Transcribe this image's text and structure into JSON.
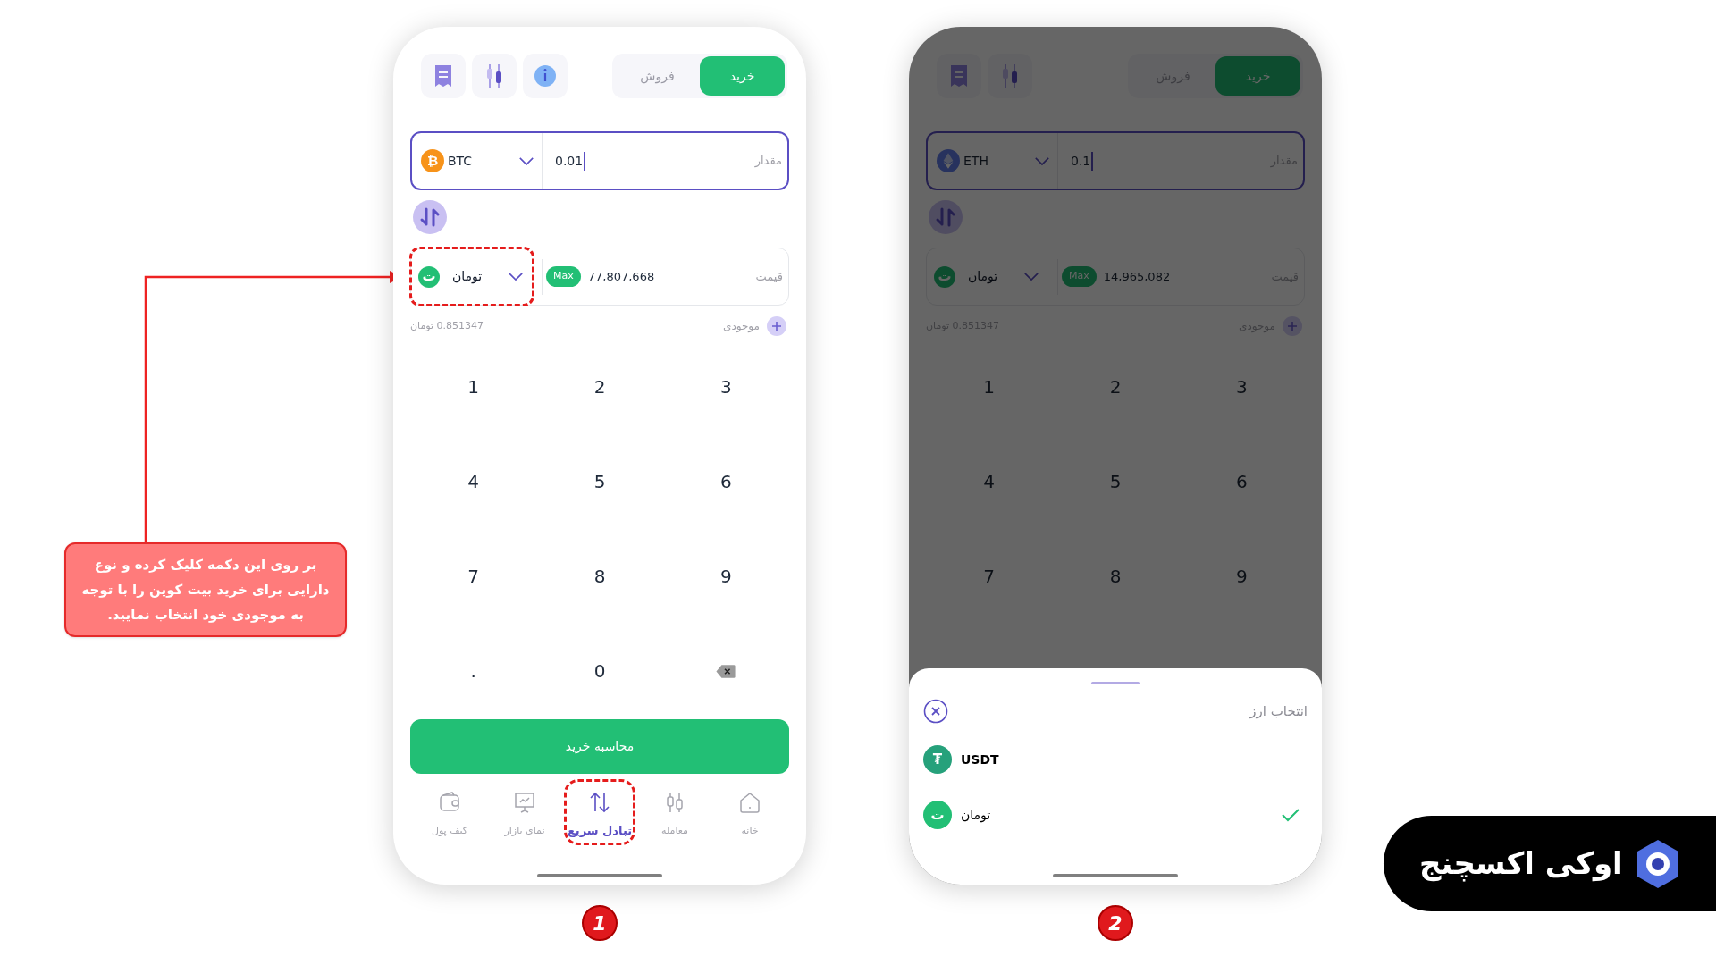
{
  "callout": {
    "text": "بر روی این دکمه کلیک کرده و نوع دارایی برای خرید بیت کوین را با توجه به موجودی خود انتخاب نمایید."
  },
  "phones": [
    {
      "marker": "2",
      "dimmed": true,
      "info_button": false,
      "tabs": [
        {
          "label": "خرید",
          "selected": true
        },
        {
          "label": "فروش",
          "selected": false
        }
      ],
      "amount": {
        "label": "مقدار",
        "value": "0.1",
        "coin": {
          "kind": "eth",
          "code": "ETH"
        }
      },
      "price": {
        "label": "قیمت",
        "value": "14,965,082",
        "max": "Max",
        "coin": {
          "kind": "toman",
          "glyph": "ت",
          "code": "تومان"
        },
        "highlighted": false
      },
      "balance": {
        "label": "موجودی",
        "value": "0.851347 تومان"
      },
      "keypad": [
        [
          "3",
          "2",
          "1"
        ],
        [
          "6",
          "5",
          "4"
        ],
        [
          "9",
          "8",
          "7"
        ]
      ],
      "backspace_key": false,
      "sheet": {
        "title": "انتخاب ارز",
        "options": [
          {
            "kind": "usdt",
            "glyph": "₮",
            "code": "USDT",
            "selected": false
          },
          {
            "kind": "toman",
            "glyph": "ت",
            "code": "تومان",
            "selected": true
          }
        ]
      }
    },
    {
      "marker": "1",
      "dimmed": false,
      "info_button": true,
      "tabs": [
        {
          "label": "خرید",
          "selected": true
        },
        {
          "label": "فروش",
          "selected": false
        }
      ],
      "amount": {
        "label": "مقدار",
        "value": "0.01",
        "coin": {
          "kind": "btc",
          "glyph": "₿",
          "code": "BTC"
        }
      },
      "price": {
        "label": "قیمت",
        "value": "77,807,668",
        "max": "Max",
        "coin": {
          "kind": "toman",
          "glyph": "ت",
          "code": "تومان"
        },
        "highlighted": true
      },
      "balance": {
        "label": "موجودی",
        "value": "0.851347 تومان"
      },
      "keypad": [
        [
          "3",
          "2",
          "1"
        ],
        [
          "6",
          "5",
          "4"
        ],
        [
          "9",
          "8",
          "7"
        ],
        [
          "0",
          "."
        ]
      ],
      "backspace_key": true,
      "submit": "محاسبه خرید",
      "nav": [
        {
          "label": "خانه",
          "kind": "home",
          "selected": false,
          "highlighted": false
        },
        {
          "label": "معامله",
          "kind": "trade",
          "selected": false,
          "highlighted": false
        },
        {
          "label": "تبادل سریع",
          "kind": "swap",
          "selected": true,
          "highlighted": true
        },
        {
          "label": "نمای بازار",
          "kind": "market",
          "selected": false,
          "highlighted": false
        },
        {
          "label": "کیف پول",
          "kind": "wallet",
          "selected": false,
          "highlighted": false
        }
      ]
    }
  ],
  "brand": {
    "name": "اوکی اکسچنج"
  }
}
